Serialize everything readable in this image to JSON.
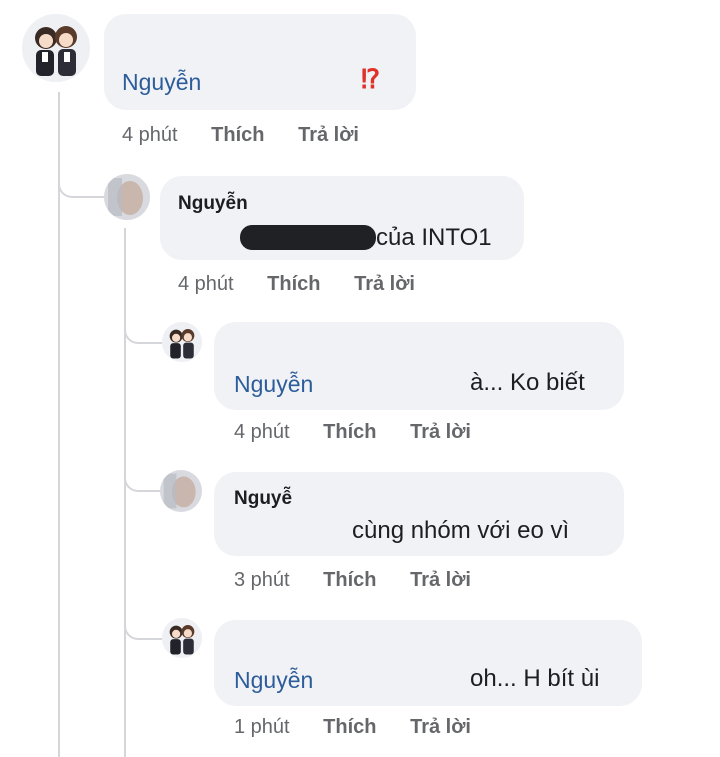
{
  "comments": [
    {
      "name": "Nguyễn",
      "text": "⁉",
      "time": "4 phút",
      "like": "Thích",
      "reply": "Trả lời"
    },
    {
      "name": "Nguyễn",
      "text": "của INTO1",
      "time": "4 phút",
      "like": "Thích",
      "reply": "Trả lời"
    },
    {
      "name": "Nguyễn",
      "text": "à... Ko biết",
      "time": "4 phút",
      "like": "Thích",
      "reply": "Trả lời"
    },
    {
      "name": "Nguyễ",
      "text": "cùng nhóm với eo vì",
      "time": "3 phút",
      "like": "Thích",
      "reply": "Trả lời"
    },
    {
      "name": "Nguyễn",
      "text": "oh... H bít ùi",
      "time": "1 phút",
      "like": "Thích",
      "reply": "Trả lời"
    }
  ],
  "colors": {
    "name_link": "#2d5c9a",
    "bubble": "#f0f2f5",
    "meta": "#65676b",
    "emoji": "#e0322a"
  }
}
